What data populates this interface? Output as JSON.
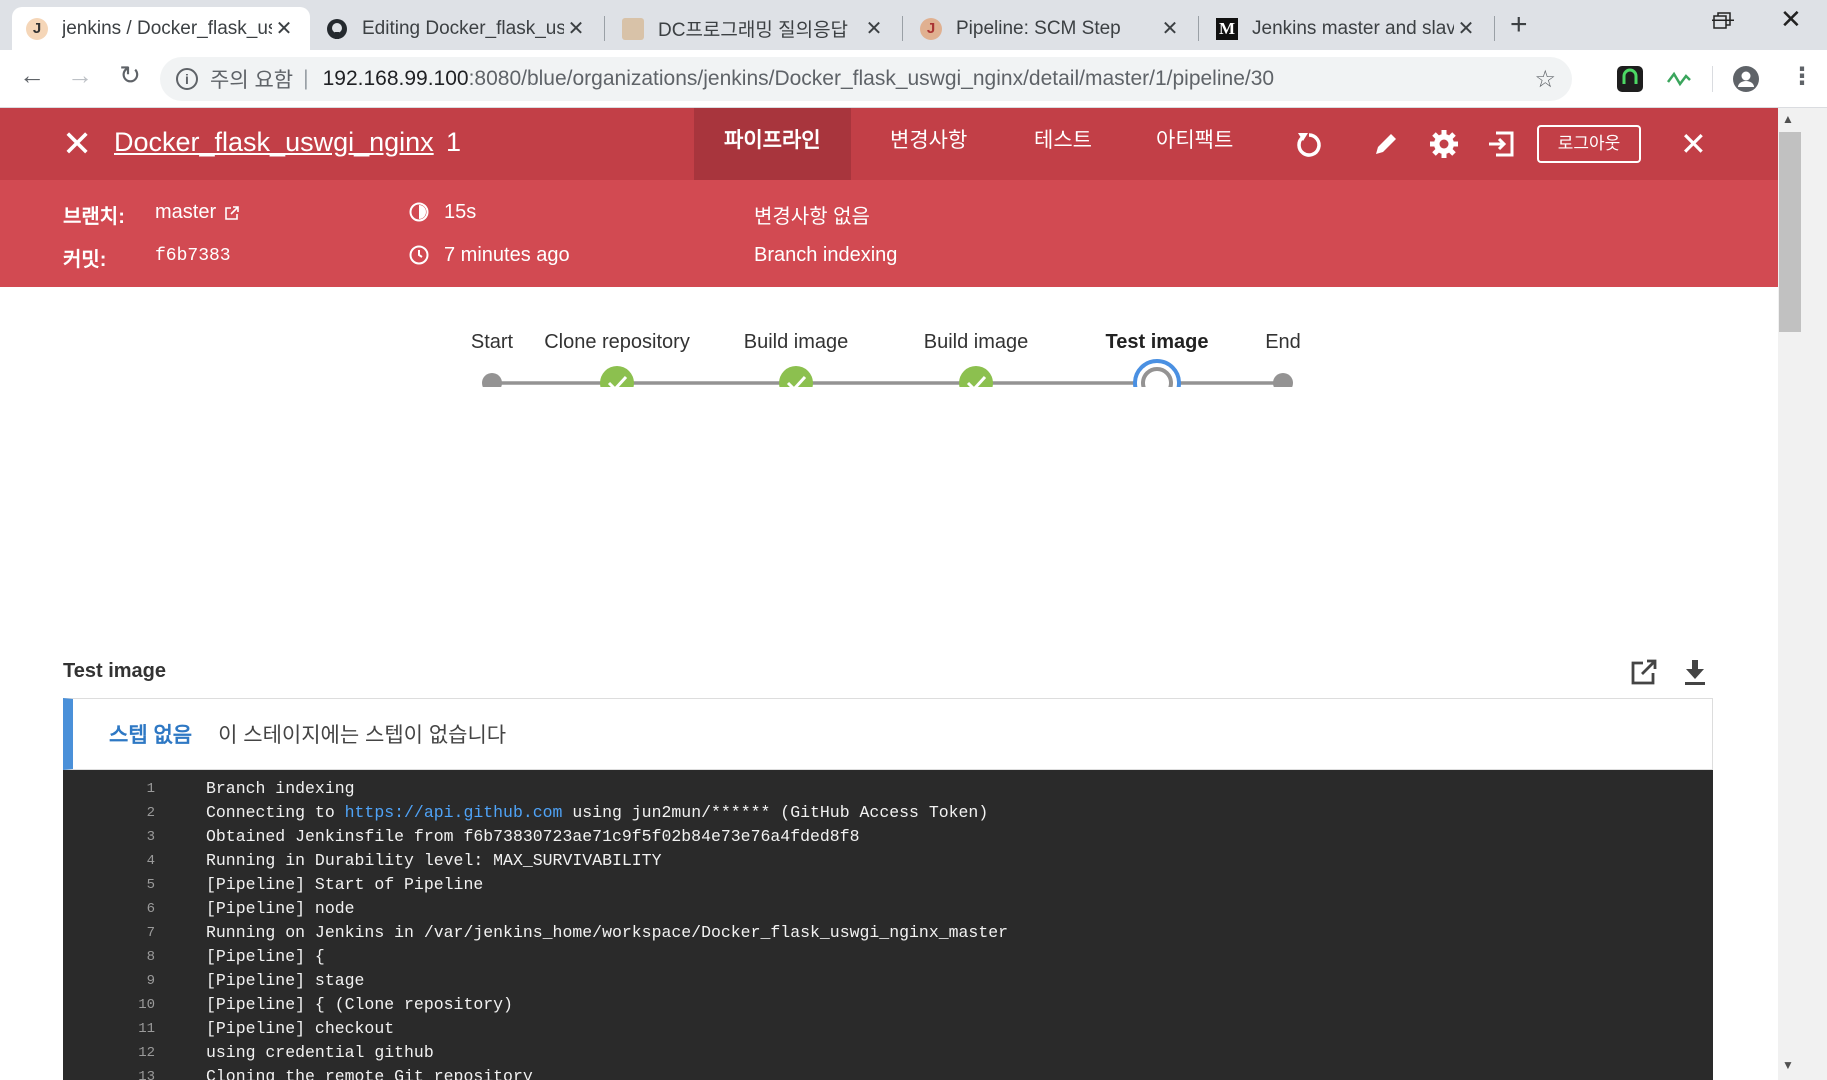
{
  "browser": {
    "tabs": [
      {
        "title": "jenkins / Docker_flask_uswgi_nginx",
        "favicon": "jenkins-icon"
      },
      {
        "title": "Editing Docker_flask_uswgi_nginx",
        "favicon": "github-icon"
      },
      {
        "title": "DC프로그래밍 질의응답",
        "favicon": "dc-icon"
      },
      {
        "title": "Pipeline: SCM Step",
        "favicon": "jenkins-icon"
      },
      {
        "title": "Jenkins master and slave",
        "favicon": "medium-icon"
      }
    ],
    "security_label": "주의 요함",
    "url_host": "192.168.99.100",
    "url_path": ":8080/blue/organizations/jenkins/Docker_flask_uswgi_nginx/detail/master/1/pipeline/30"
  },
  "header": {
    "pipeline_name": "Docker_flask_uswgi_nginx",
    "run_number": "1",
    "tabs": [
      "파이프라인",
      "변경사항",
      "테스트",
      "아티팩트"
    ],
    "logout_label": "로그아웃",
    "bg_color": "#c23f47"
  },
  "summary": {
    "branch_label": "브랜치:",
    "branch_value": "master",
    "commit_label": "커밋:",
    "commit_value": "f6b7383",
    "duration": "15s",
    "time_ago": "7 minutes ago",
    "changes": "변경사항 없음",
    "cause": "Branch indexing"
  },
  "pipeline": {
    "stages": [
      {
        "label": "Start",
        "status": "node"
      },
      {
        "label": "Clone repository",
        "status": "success"
      },
      {
        "label": "Build image",
        "status": "success"
      },
      {
        "label": "Build image",
        "status": "success"
      },
      {
        "label": "Test image",
        "status": "running"
      },
      {
        "label": "End",
        "status": "node"
      }
    ],
    "success_color": "#8cc04f",
    "running_color": "#4a90e2"
  },
  "log": {
    "stage_title": "Test image",
    "no_steps_key": "스텝 없음",
    "no_steps_text": "이 스테이지에는 스텝이 없습니다",
    "lines": [
      {
        "no": "1",
        "text": "Branch indexing"
      },
      {
        "no": "2",
        "pre": "Connecting to ",
        "link": "https://api.github.com",
        "post": " using jun2mun/****** (GitHub Access Token)"
      },
      {
        "no": "3",
        "text": "Obtained Jenkinsfile from f6b73830723ae71c9f5f02b84e73e76a4fded8f8"
      },
      {
        "no": "4",
        "text": "Running in Durability level: MAX_SURVIVABILITY"
      },
      {
        "no": "5",
        "text": "[Pipeline] Start of Pipeline"
      },
      {
        "no": "6",
        "text": "[Pipeline] node"
      },
      {
        "no": "7",
        "text": "Running on Jenkins in /var/jenkins_home/workspace/Docker_flask_uswgi_nginx_master"
      },
      {
        "no": "8",
        "text": "[Pipeline] {"
      },
      {
        "no": "9",
        "text": "[Pipeline] stage"
      },
      {
        "no": "10",
        "text": "[Pipeline] { (Clone repository)"
      },
      {
        "no": "11",
        "text": "[Pipeline] checkout"
      },
      {
        "no": "12",
        "text": "using credential github"
      },
      {
        "no": "13",
        "text": "Cloning the remote Git repository"
      }
    ]
  }
}
